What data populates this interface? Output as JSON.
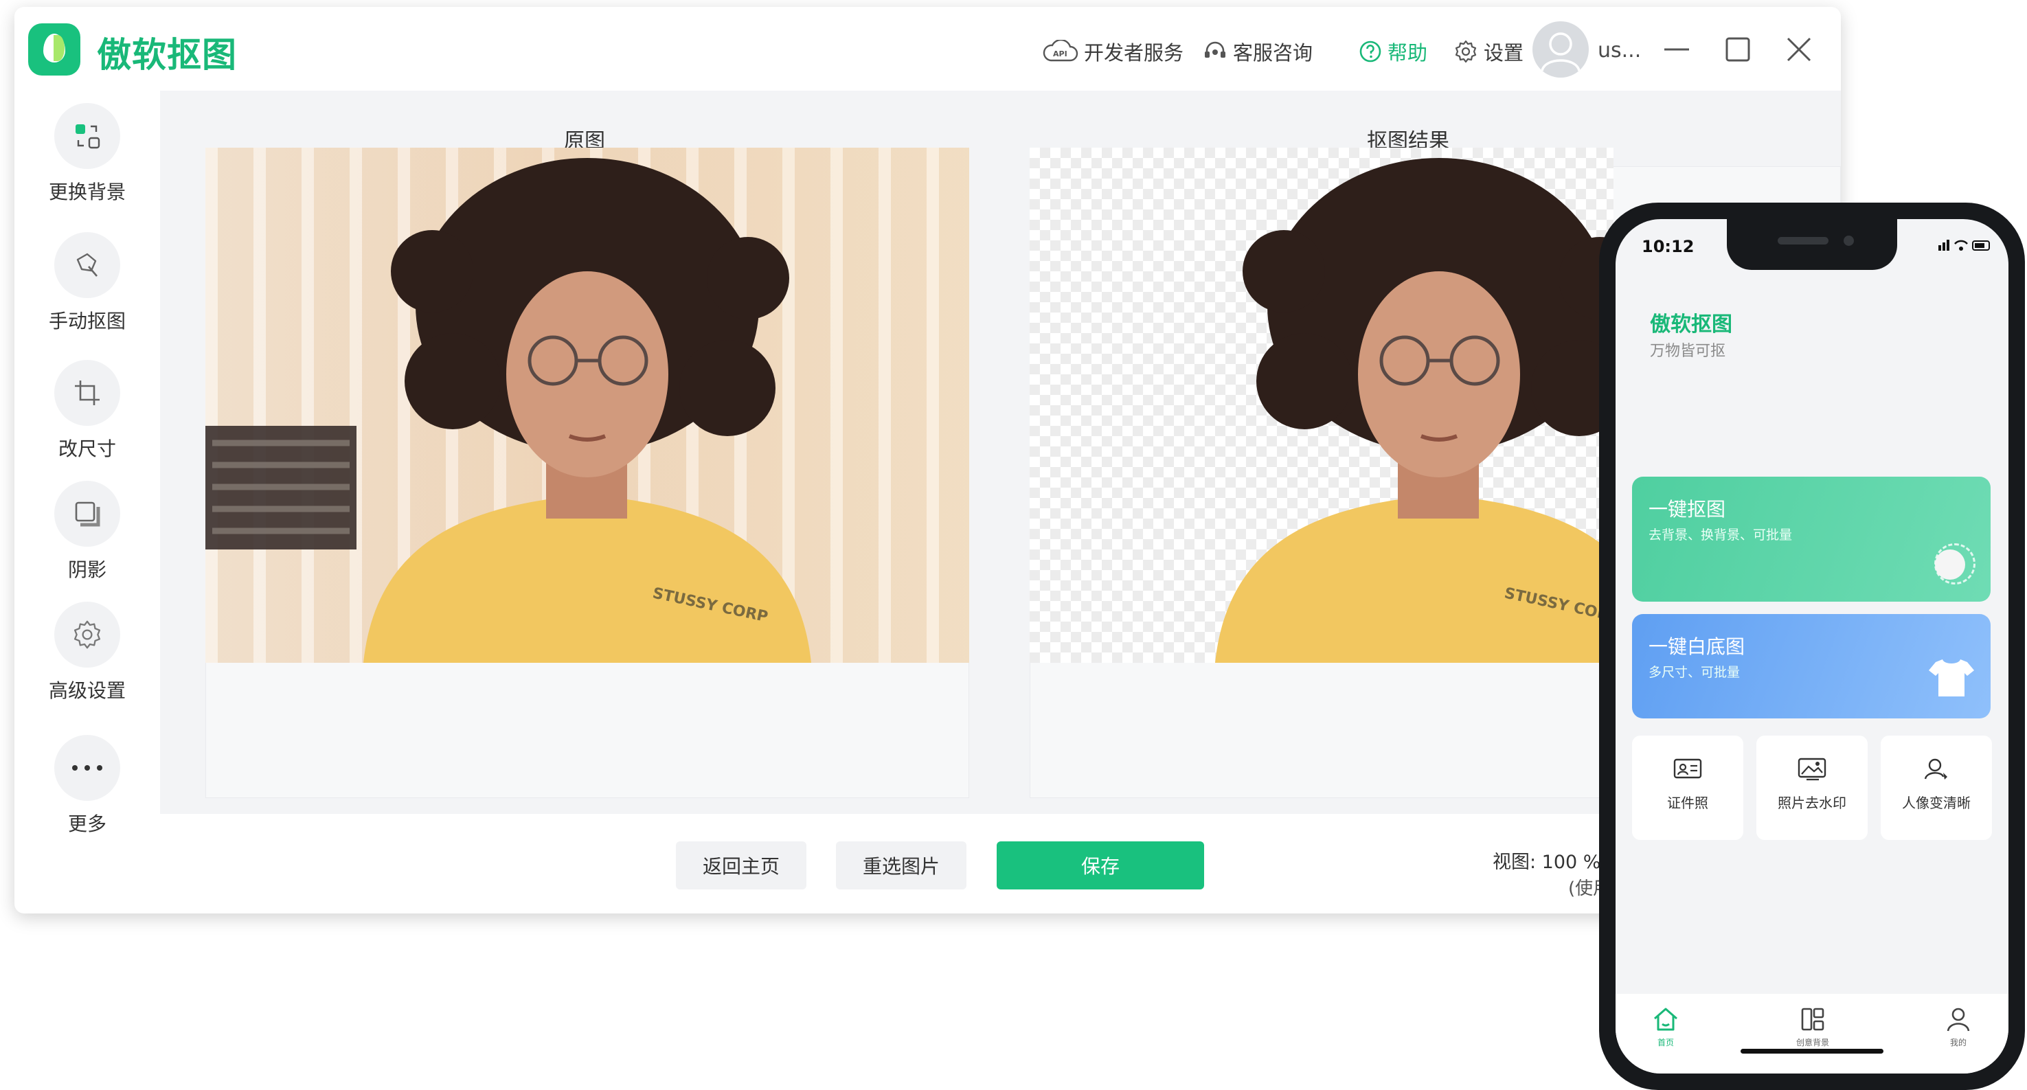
{
  "app": {
    "title": "傲软抠图",
    "toolbar": {
      "developer": "开发者服务",
      "developer_icon": "api-cloud-icon",
      "support": "客服咨询",
      "help": "帮助",
      "settings": "设置",
      "username": "us..."
    },
    "colors": {
      "brand": "#19c17e",
      "brand_text": "#19b878"
    }
  },
  "sidebar": {
    "items": [
      {
        "label": "更换背景",
        "icon": "swap-background-icon"
      },
      {
        "label": "手动抠图",
        "icon": "lasso-cut-icon"
      },
      {
        "label": "改尺寸",
        "icon": "crop-icon"
      },
      {
        "label": "阴影",
        "icon": "shadow-icon"
      },
      {
        "label": "高级设置",
        "icon": "gear-icon"
      },
      {
        "label": "更多",
        "icon": "more-dots-icon"
      }
    ]
  },
  "main": {
    "original_title": "原图",
    "result_title": "抠图结果",
    "shirt_text": "STUSSY CORP"
  },
  "bottom": {
    "back_home": "返回主页",
    "reselect": "重选图片",
    "save": "保存",
    "view_zoom": "视图: 100 %",
    "hint": "(使用"
  },
  "phone": {
    "time": "10:12",
    "title": "傲软抠图",
    "subtitle": "万物皆可抠",
    "card1": {
      "title": "一键抠图",
      "sub": "去背景、换背景、可批量"
    },
    "card2": {
      "title": "一键白底图",
      "sub": "多尺寸、可批量"
    },
    "tools": [
      {
        "label": "证件照",
        "icon": "id-card-icon"
      },
      {
        "label": "照片去水印",
        "icon": "photo-watermark-icon"
      },
      {
        "label": "人像变清晰",
        "icon": "portrait-enhance-icon"
      }
    ],
    "tabs": [
      {
        "label": "首页",
        "icon": "home-icon"
      },
      {
        "label": "创意背景",
        "icon": "layout-icon"
      },
      {
        "label": "我的",
        "icon": "user-icon"
      }
    ]
  }
}
